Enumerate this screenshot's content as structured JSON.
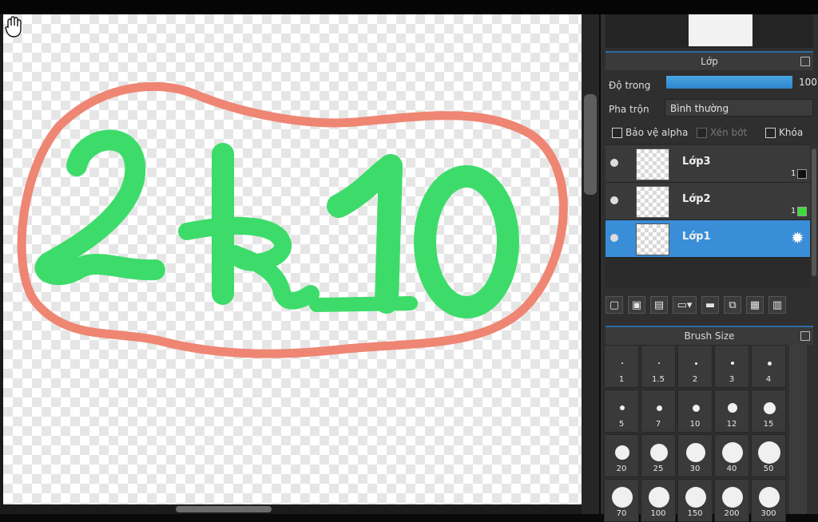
{
  "canvas": {
    "text": "2k10",
    "stroke_color": "#3ddc6a",
    "outline_color": "#ee8673"
  },
  "layer_panel": {
    "title": "Lớp",
    "opacity_label": "Độ trong",
    "opacity_value": "100",
    "blend_label": "Pha trộn",
    "blend_value": "Bình thường",
    "protect_alpha": "Bảo vệ alpha",
    "clipping": "Xén bớt",
    "lock": "Khóa",
    "layers": [
      {
        "name": "Lớp3",
        "count": "1",
        "swatch": "#111111",
        "selected": false
      },
      {
        "name": "Lớp2",
        "count": "1",
        "swatch": "#3ddc3d",
        "selected": false
      },
      {
        "name": "Lớp1",
        "count": "",
        "swatch": "",
        "selected": true
      }
    ],
    "accent": "#3a8ed8"
  },
  "brush_panel": {
    "title": "Brush Size",
    "sizes": [
      "1",
      "1.5",
      "2",
      "3",
      "4",
      "5",
      "7",
      "10",
      "12",
      "15",
      "20",
      "25",
      "30",
      "40",
      "50",
      "70",
      "100",
      "150",
      "200",
      "300"
    ]
  },
  "icons": {
    "hand": "hand-tool-icon",
    "gear": "gear-icon"
  }
}
